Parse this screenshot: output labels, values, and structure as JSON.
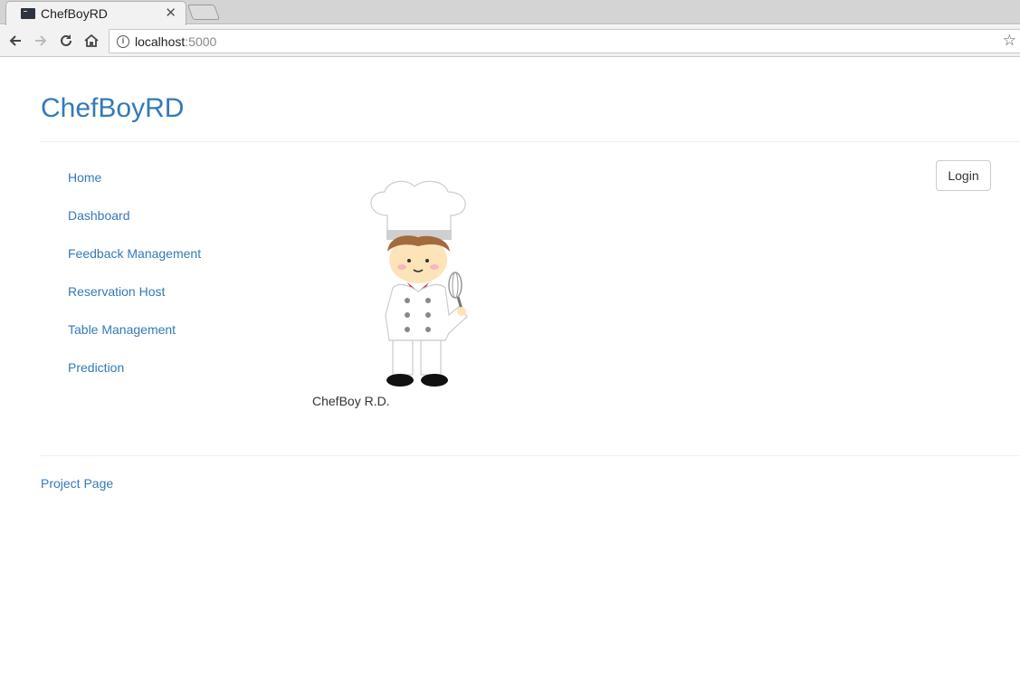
{
  "browser": {
    "tab_title": "ChefBoyRD",
    "url_host": "localhost",
    "url_port": ":5000"
  },
  "brand": "ChefBoyRD",
  "nav": [
    "Home",
    "Dashboard",
    "Feedback Management",
    "Reservation Host",
    "Table Management",
    "Prediction"
  ],
  "login_label": "Login",
  "caption": "ChefBoy R.D.",
  "footer_link": "Project Page",
  "colors": {
    "link": "#337ab7",
    "text": "#333333"
  }
}
